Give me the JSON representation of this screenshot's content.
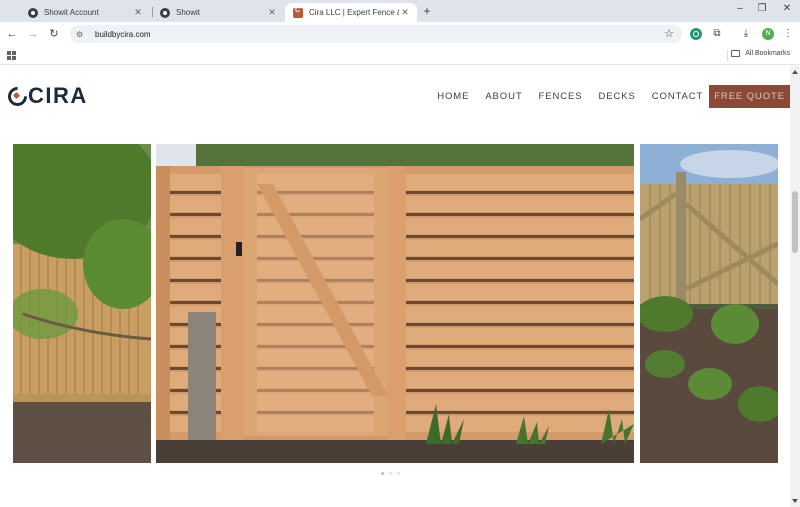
{
  "browser": {
    "tabs": [
      {
        "title": "Showit Account",
        "active": false,
        "favicon": "showit-icon"
      },
      {
        "title": "Showit",
        "active": false,
        "favicon": "showit-icon"
      },
      {
        "title": "Cira LLC | Expert Fence & Deck Ins",
        "active": true,
        "favicon": "cira-icon"
      }
    ],
    "url": "buildbycira.com",
    "profile_initial": "N",
    "bookmarks_label": "All Bookmarks"
  },
  "site": {
    "logo_text": "CIRA",
    "nav": [
      "HOME",
      "ABOUT",
      "FENCES",
      "DECKS",
      "CONTACT"
    ],
    "cta": "FREE QUOTE",
    "brand_colors": {
      "navy": "#1d2a3a",
      "accent": "#8b4a36"
    },
    "gallery": {
      "slides": [
        "fence-left-photo",
        "gate-fence-photo",
        "fence-right-photo"
      ],
      "active_dot": 0,
      "dot_count": 3
    }
  }
}
